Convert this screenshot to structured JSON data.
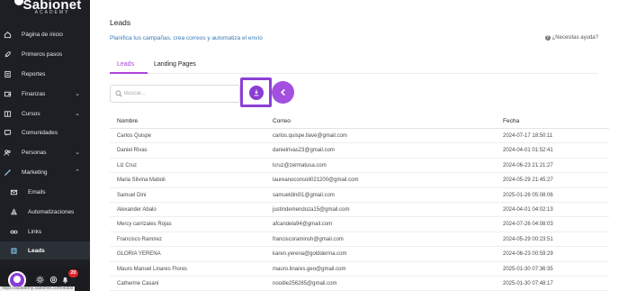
{
  "brand": {
    "name": "Sabionet",
    "tagline": "ACADEMY"
  },
  "sidebar": {
    "items": [
      {
        "label": "Página de inicio",
        "icon": "home-icon",
        "name": "sidebar-item-inicio"
      },
      {
        "label": "Primeros pasos",
        "icon": "rocket-icon",
        "name": "sidebar-item-primeros-pasos"
      },
      {
        "label": "Reportes",
        "icon": "report-icon",
        "name": "sidebar-item-reportes"
      },
      {
        "label": "Finanzas",
        "icon": "wallet-icon",
        "name": "sidebar-item-finanzas",
        "chevron": "⌄"
      },
      {
        "label": "Cursos",
        "icon": "course-icon",
        "name": "sidebar-item-cursos",
        "chevron": "⌄"
      },
      {
        "label": "Comunidades",
        "icon": "chat-icon",
        "name": "sidebar-item-comunidades"
      },
      {
        "label": "Personas",
        "icon": "people-icon",
        "name": "sidebar-item-personas",
        "chevron": "⌄"
      },
      {
        "label": "Marketing",
        "icon": "magic-wand-icon",
        "name": "sidebar-item-marketing",
        "chevron": "⌃"
      },
      {
        "label": "Emails",
        "icon": "mail-icon",
        "name": "sidebar-item-emails",
        "sub": true
      },
      {
        "label": "Automatizaciones",
        "icon": "automation-icon",
        "name": "sidebar-item-automatizaciones",
        "sub": true
      },
      {
        "label": "Links",
        "icon": "link-icon",
        "name": "sidebar-item-links",
        "sub": true
      },
      {
        "label": "Leads",
        "icon": "leads-icon",
        "name": "sidebar-item-leads",
        "sub": true,
        "active": true
      }
    ],
    "notification_count": "20",
    "status_url": "https://academy.sabionet.com/leads"
  },
  "header": {
    "title": "Leads",
    "subtitle": "Planifica tus campañas, crea correos y automatiza el envío",
    "help": "¿Necesitas ayuda?"
  },
  "tabs": [
    {
      "label": "Leads",
      "active": true
    },
    {
      "label": "Landing Pages",
      "active": false
    }
  ],
  "search": {
    "placeholder": "Buscar...",
    "value": ""
  },
  "table": {
    "columns": [
      "Nombre",
      "Correo",
      "Fecha"
    ],
    "rows": [
      [
        "Carlos Quispe",
        "carlos.quispe.llave@gmail.com",
        "2024-07-17 18:50:11"
      ],
      [
        "Daniel Rivas",
        "danielrivas23@gmail.com",
        "2024-04-01 01:52:41"
      ],
      [
        "Liz Cruz",
        "lcruz@zermatusa.com",
        "2024-06-23 21:21:27"
      ],
      [
        "Maria Silvina Maboli",
        "laureanoconsoli021200@gmail.com",
        "2024-05-29 21:45:27"
      ],
      [
        "Samuel Dini",
        "samueldini01@gmail.com",
        "2025-01-26 05:08:06"
      ],
      [
        "Alexander Abalo",
        "justindemendoza15@gmail.com",
        "2024-04-01 04:02:13"
      ],
      [
        "Mercy carrizales Rojas",
        "afcandela94@gmail.com",
        "2024-07-26 04:08:03"
      ],
      [
        "Francisco Ramirez",
        "franciscoraminsh@gmail.com",
        "2024-05-29 00:23:51"
      ],
      [
        "GLORIA YERENA",
        "karen.yerena@goldderma.com",
        "2024-06-23 00:59:29"
      ],
      [
        "Mauro Manuel Linares Flores",
        "mauro.linares.geo@gmail.com",
        "2025-01-30 07:36:35"
      ],
      [
        "Catherine Casani",
        "noodle256285@gmail.com",
        "2025-01-30 07:48:17"
      ]
    ]
  },
  "colors": {
    "accent": "#8a3cd4",
    "sidebar_bg": "#1d1f24",
    "link": "#3a78b5"
  }
}
